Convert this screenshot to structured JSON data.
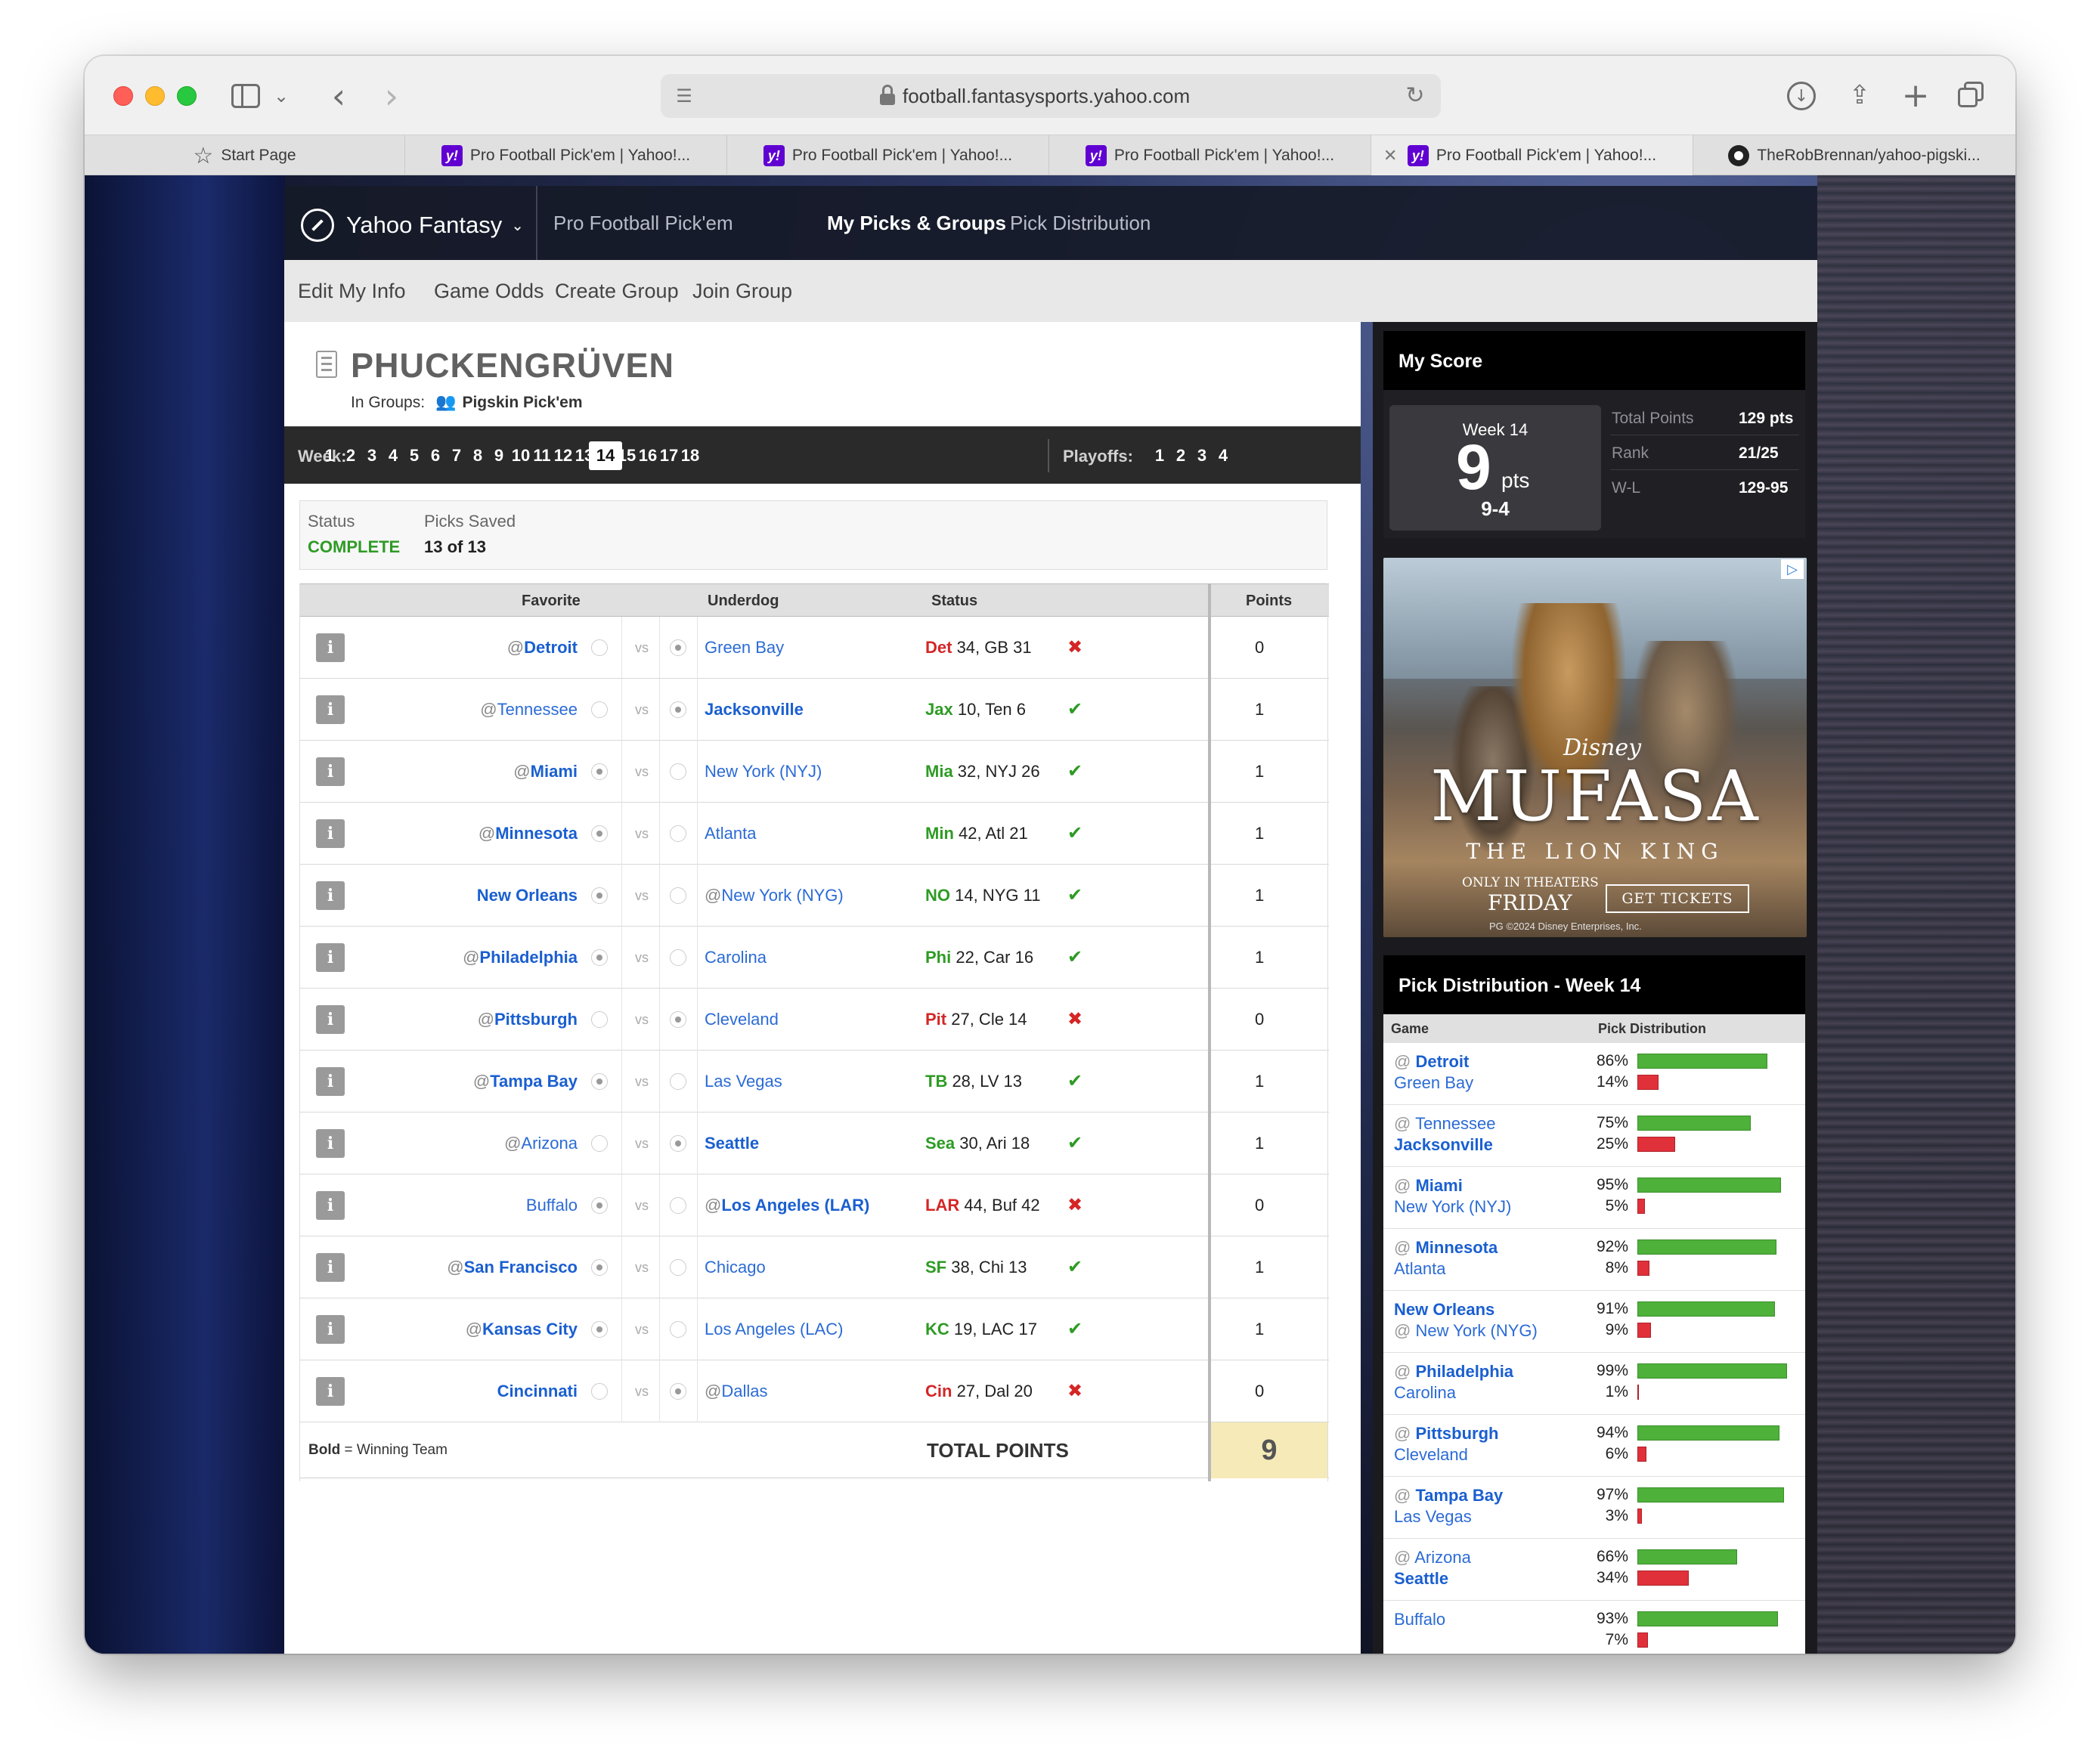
{
  "browser": {
    "url": "football.fantasysports.yahoo.com",
    "tabs": [
      {
        "label": "Start Page",
        "icon": "star-icon"
      },
      {
        "label": "Pro Football Pick'em | Yahoo!...",
        "icon": "yahoo-icon"
      },
      {
        "label": "Pro Football Pick'em | Yahoo!...",
        "icon": "yahoo-icon"
      },
      {
        "label": "Pro Football Pick'em | Yahoo!...",
        "icon": "yahoo-icon"
      },
      {
        "label": "Pro Football Pick'em | Yahoo!...",
        "icon": "yahoo-icon",
        "active": true
      },
      {
        "label": "TheRobBrennan/yahoo-pigski...",
        "icon": "github-icon"
      }
    ]
  },
  "nav": {
    "logo": "Yahoo Fantasy",
    "links": [
      "Pro Football Pick'em",
      "My Picks & Groups",
      "Pick Distribution"
    ],
    "active": "My Picks & Groups"
  },
  "subnav": [
    "Edit My Info",
    "Game Odds",
    "Create Group",
    "Join Group"
  ],
  "team": {
    "name": "PHUCKENGRÜVEN",
    "groups_label": "In Groups:",
    "group": "Pigskin Pick'em"
  },
  "weeks": {
    "label": "Week:",
    "list": [
      "1",
      "2",
      "3",
      "4",
      "5",
      "6",
      "7",
      "8",
      "9",
      "10",
      "11",
      "12",
      "13",
      "14",
      "15",
      "16",
      "17",
      "18"
    ],
    "current": "14",
    "playoffs_label": "Playoffs:",
    "playoffs": [
      "1",
      "2",
      "3",
      "4"
    ]
  },
  "status": {
    "status_label": "Status",
    "status_value": "COMPLETE",
    "saved_label": "Picks Saved",
    "saved_value": "13 of 13"
  },
  "table": {
    "headers": {
      "favorite": "Favorite",
      "underdog": "Underdog",
      "status": "Status",
      "points": "Points"
    },
    "rows": [
      {
        "fav": "Detroit",
        "fav_home": true,
        "und": "Green Bay",
        "und_home": false,
        "winner": "fav",
        "pick": "und",
        "score_team": "Det",
        "score_rest": "34, GB 31",
        "correct": false,
        "points": "0"
      },
      {
        "fav": "Tennessee",
        "fav_home": true,
        "und": "Jacksonville",
        "und_home": false,
        "winner": "und",
        "pick": "und",
        "score_team": "Jax",
        "score_rest": "10, Ten 6",
        "correct": true,
        "points": "1"
      },
      {
        "fav": "Miami",
        "fav_home": true,
        "und": "New York (NYJ)",
        "und_home": false,
        "winner": "fav",
        "pick": "fav",
        "score_team": "Mia",
        "score_rest": "32, NYJ 26",
        "correct": true,
        "points": "1"
      },
      {
        "fav": "Minnesota",
        "fav_home": true,
        "und": "Atlanta",
        "und_home": false,
        "winner": "fav",
        "pick": "fav",
        "score_team": "Min",
        "score_rest": "42, Atl 21",
        "correct": true,
        "points": "1"
      },
      {
        "fav": "New Orleans",
        "fav_home": false,
        "und": "New York (NYG)",
        "und_home": true,
        "winner": "fav",
        "pick": "fav",
        "score_team": "NO",
        "score_rest": "14, NYG 11",
        "correct": true,
        "points": "1"
      },
      {
        "fav": "Philadelphia",
        "fav_home": true,
        "und": "Carolina",
        "und_home": false,
        "winner": "fav",
        "pick": "fav",
        "score_team": "Phi",
        "score_rest": "22, Car 16",
        "correct": true,
        "points": "1"
      },
      {
        "fav": "Pittsburgh",
        "fav_home": true,
        "und": "Cleveland",
        "und_home": false,
        "winner": "fav",
        "pick": "und",
        "score_team": "Pit",
        "score_rest": "27, Cle 14",
        "correct": false,
        "points": "0"
      },
      {
        "fav": "Tampa Bay",
        "fav_home": true,
        "und": "Las Vegas",
        "und_home": false,
        "winner": "fav",
        "pick": "fav",
        "score_team": "TB",
        "score_rest": "28, LV 13",
        "correct": true,
        "points": "1"
      },
      {
        "fav": "Arizona",
        "fav_home": true,
        "und": "Seattle",
        "und_home": false,
        "winner": "und",
        "pick": "und",
        "score_team": "Sea",
        "score_rest": "30, Ari 18",
        "correct": true,
        "points": "1"
      },
      {
        "fav": "Buffalo",
        "fav_home": false,
        "und": "Los Angeles (LAR)",
        "und_home": true,
        "winner": "und",
        "pick": "fav",
        "score_team": "LAR",
        "score_rest": "44, Buf 42",
        "correct": false,
        "points": "0"
      },
      {
        "fav": "San Francisco",
        "fav_home": true,
        "und": "Chicago",
        "und_home": false,
        "winner": "fav",
        "pick": "fav",
        "score_team": "SF",
        "score_rest": "38, Chi 13",
        "correct": true,
        "points": "1"
      },
      {
        "fav": "Kansas City",
        "fav_home": true,
        "und": "Los Angeles (LAC)",
        "und_home": false,
        "winner": "fav",
        "pick": "fav",
        "score_team": "KC",
        "score_rest": "19, LAC 17",
        "correct": true,
        "points": "1"
      },
      {
        "fav": "Cincinnati",
        "fav_home": false,
        "und": "Dallas",
        "und_home": true,
        "winner": "fav",
        "pick": "und",
        "score_team": "Cin",
        "score_rest": "27, Dal 20",
        "correct": false,
        "points": "0"
      }
    ],
    "vs": "vs",
    "at": "@",
    "footer_note_bold": "Bold",
    "footer_note_rest": " = Winning Team",
    "total_label": "TOTAL POINTS",
    "total_value": "9"
  },
  "my_score": {
    "title": "My Score",
    "week_label": "Week 14",
    "points": "9",
    "points_unit": "pts",
    "record": "9-4",
    "stats": [
      {
        "label": "Total Points",
        "value": "129 pts"
      },
      {
        "label": "Rank",
        "value": "21/25"
      },
      {
        "label": "W-L",
        "value": "129-95"
      }
    ]
  },
  "ad": {
    "brand": "Disney",
    "title": "MUFASA",
    "subtitle": "THE LION KING",
    "line1": "ONLY IN THEATERS",
    "line2": "FRIDAY",
    "button": "GET TICKETS",
    "legal": "PG  ©2024 Disney Enterprises, Inc."
  },
  "distribution": {
    "title": "Pick Distribution - Week 14",
    "col_game": "Game",
    "col_dist": "Pick Distribution",
    "rows": [
      {
        "t1": "Detroit",
        "t1_home": true,
        "t1_win": true,
        "t2": "Green Bay",
        "t2_home": false,
        "t2_win": false,
        "p1": 86,
        "p2": 14
      },
      {
        "t1": "Tennessee",
        "t1_home": true,
        "t1_win": false,
        "t2": "Jacksonville",
        "t2_home": false,
        "t2_win": true,
        "p1": 75,
        "p2": 25
      },
      {
        "t1": "Miami",
        "t1_home": true,
        "t1_win": true,
        "t2": "New York (NYJ)",
        "t2_home": false,
        "t2_win": false,
        "p1": 95,
        "p2": 5
      },
      {
        "t1": "Minnesota",
        "t1_home": true,
        "t1_win": true,
        "t2": "Atlanta",
        "t2_home": false,
        "t2_win": false,
        "p1": 92,
        "p2": 8
      },
      {
        "t1": "New Orleans",
        "t1_home": false,
        "t1_win": true,
        "t2": "New York (NYG)",
        "t2_home": true,
        "t2_win": false,
        "p1": 91,
        "p2": 9
      },
      {
        "t1": "Philadelphia",
        "t1_home": true,
        "t1_win": true,
        "t2": "Carolina",
        "t2_home": false,
        "t2_win": false,
        "p1": 99,
        "p2": 1
      },
      {
        "t1": "Pittsburgh",
        "t1_home": true,
        "t1_win": true,
        "t2": "Cleveland",
        "t2_home": false,
        "t2_win": false,
        "p1": 94,
        "p2": 6
      },
      {
        "t1": "Tampa Bay",
        "t1_home": true,
        "t1_win": true,
        "t2": "Las Vegas",
        "t2_home": false,
        "t2_win": false,
        "p1": 97,
        "p2": 3
      },
      {
        "t1": "Arizona",
        "t1_home": true,
        "t1_win": false,
        "t2": "Seattle",
        "t2_home": false,
        "t2_win": true,
        "p1": 66,
        "p2": 34
      },
      {
        "t1": "Buffalo",
        "t1_home": false,
        "t1_win": false,
        "t2": "",
        "t2_home": true,
        "t2_win": true,
        "p1": 93,
        "p2": 7
      }
    ]
  },
  "colors": {
    "link": "#2b6bd6",
    "win_green": "#2e9b24",
    "loss_red": "#d42626",
    "bar_green": "#4eb13a",
    "bar_red": "#e0313a",
    "total_bg": "#f5eab8",
    "yahoo_purple": "#6001d2"
  }
}
